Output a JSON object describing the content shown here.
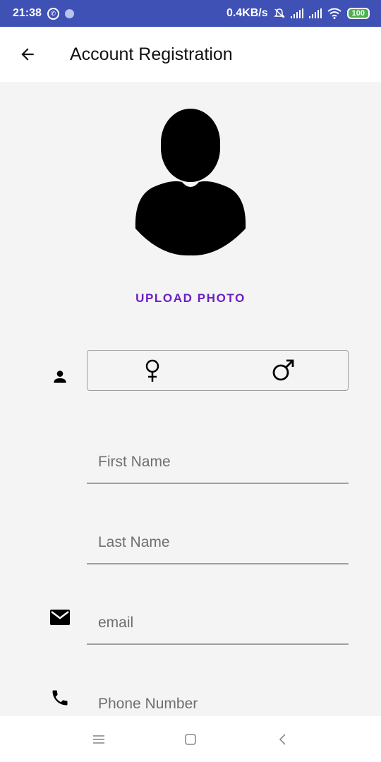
{
  "status_bar": {
    "time": "21:38",
    "network_speed": "0.4KB/s",
    "battery": "100",
    "icons": [
      "whatsapp-icon",
      "notification-dot-icon",
      "mute-icon",
      "signal-icon",
      "signal-icon",
      "wifi-icon",
      "battery-icon"
    ]
  },
  "app_bar": {
    "title": "Account Registration",
    "back_icon": "arrow-back-icon"
  },
  "profile": {
    "upload_label": "UPLOAD PHOTO"
  },
  "gender": {
    "female_icon": "female-icon",
    "male_icon": "male-icon",
    "row_icon": "person-icon"
  },
  "form": {
    "first_name": {
      "placeholder": "First Name",
      "value": ""
    },
    "last_name": {
      "placeholder": "Last Name",
      "value": ""
    },
    "email": {
      "placeholder": "email",
      "value": ""
    },
    "phone": {
      "placeholder": "Phone Number",
      "value": ""
    }
  },
  "nav_bar": {
    "icons": [
      "menu-icon",
      "home-icon",
      "back-nav-icon"
    ]
  },
  "colors": {
    "status_bar": "#3f51b5",
    "accent": "#6a1fc4",
    "background": "#f4f4f4"
  }
}
